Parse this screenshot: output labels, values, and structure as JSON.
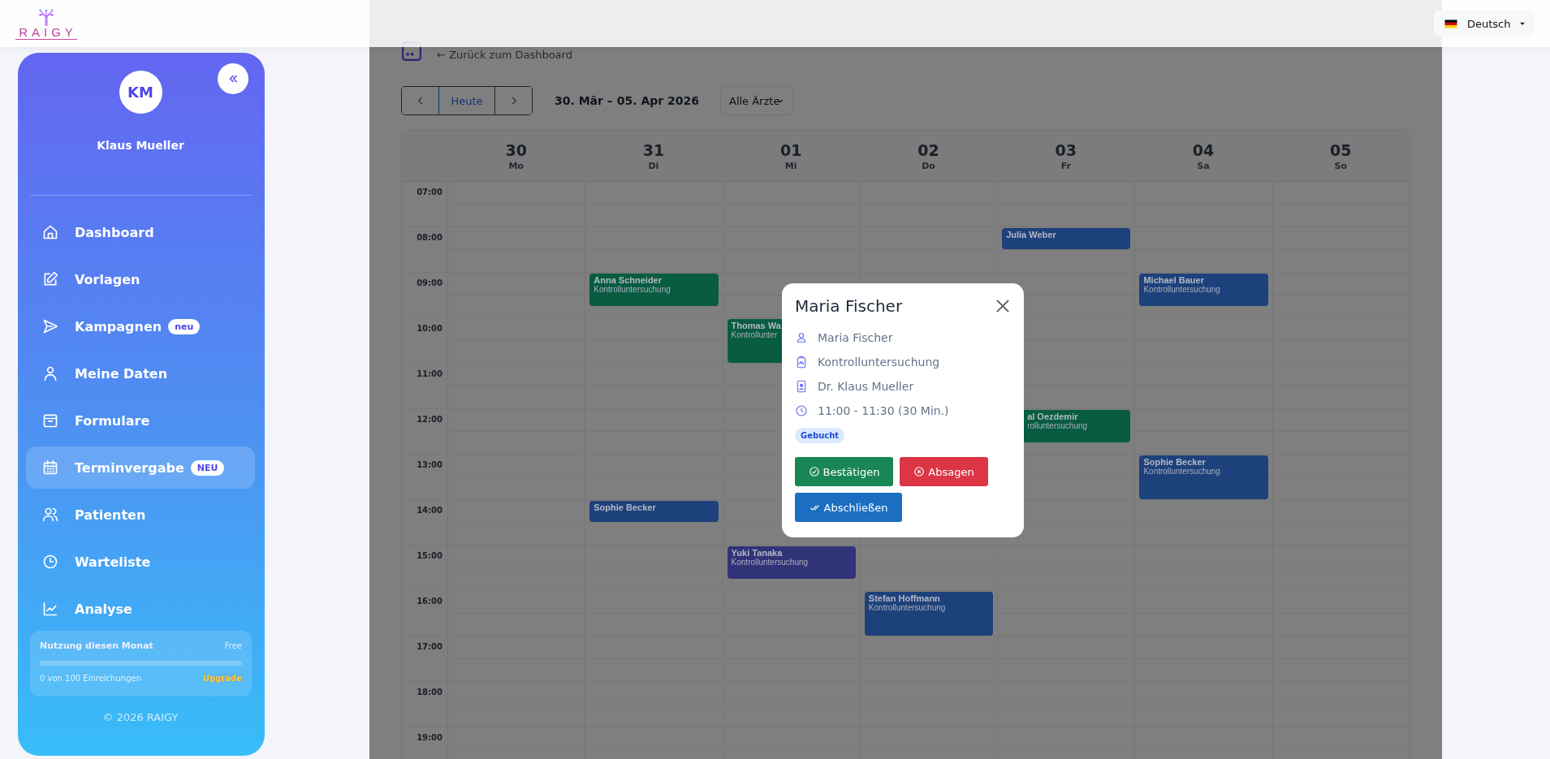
{
  "header": {
    "logo_text": "RAIGY",
    "language": "Deutsch"
  },
  "sidebar": {
    "avatar_initials": "KM",
    "user_name": "Klaus Mueller",
    "items": [
      {
        "label": "Dashboard",
        "selected": false
      },
      {
        "label": "Vorlagen",
        "selected": false
      },
      {
        "label": "Kampagnen",
        "badge": "neu",
        "selected": false
      },
      {
        "label": "Meine Daten",
        "selected": false
      },
      {
        "label": "Formulare",
        "selected": false
      },
      {
        "label": "Terminvergabe",
        "badge": "NEU",
        "selected": true
      },
      {
        "label": "Patienten",
        "selected": false
      },
      {
        "label": "Warteliste",
        "selected": false
      },
      {
        "label": "Analyse",
        "selected": false
      }
    ],
    "usage": {
      "title": "Nutzung diesen Monat",
      "plan": "Free",
      "level": 0,
      "count": "0 von 100 Einreichungen",
      "upgrade": "Upgrade"
    },
    "footer": "© 2026 RAIGY"
  },
  "calendar": {
    "back_link": "← Zurück zum Dashboard",
    "today": "Heute",
    "range": "30. Mär – 05. Apr 2026",
    "doctor_filter": "Alle Ärzte",
    "hours": [
      "07:00",
      "08:00",
      "09:00",
      "10:00",
      "11:00",
      "12:00",
      "13:00",
      "14:00",
      "15:00",
      "16:00",
      "17:00",
      "18:00",
      "19:00"
    ],
    "days": [
      {
        "date": "30",
        "weekday": "Mo",
        "slots": [
          {
            "kind": "free"
          },
          {
            "kind": "free"
          },
          {
            "kind": "free"
          },
          {
            "kind": "free"
          },
          {
            "kind": "free"
          },
          {
            "kind": "free"
          },
          {
            "kind": "free"
          },
          {
            "kind": "free"
          },
          {
            "kind": "free"
          },
          {
            "kind": "free"
          },
          {
            "kind": "free"
          },
          {
            "kind": "free"
          },
          {
            "kind": "free"
          }
        ]
      },
      {
        "date": "31",
        "weekday": "Di",
        "slots": [
          {
            "kind": "free"
          },
          {
            "kind": "free"
          },
          {
            "kind": "medium",
            "title": "Anna Schneider",
            "subtitle": "Kontrolluntersuchung",
            "color": "#085c40"
          },
          {
            "kind": "free"
          },
          {
            "kind": "free"
          },
          {
            "kind": "free"
          },
          {
            "kind": "free"
          },
          {
            "kind": "short",
            "title": "Sophie Becker",
            "color": "#1d417b"
          },
          {
            "kind": "free"
          },
          {
            "kind": "free"
          },
          {
            "kind": "free"
          },
          {
            "kind": "free"
          },
          {
            "kind": "free"
          }
        ]
      },
      {
        "date": "01",
        "weekday": "Mi",
        "slots": [
          {
            "kind": "free"
          },
          {
            "kind": "free"
          },
          {
            "kind": "free"
          },
          {
            "kind": "long",
            "title": "Thomas Wa",
            "subtitle": "Kontrollunter",
            "color": "#085c40"
          },
          {
            "kind": "free"
          },
          {
            "kind": "free"
          },
          {
            "kind": "free"
          },
          {
            "kind": "free"
          },
          {
            "kind": "medium",
            "title": "Yuki Tanaka",
            "subtitle": "Kontrolluntersuchung",
            "color": "#313378"
          },
          {
            "kind": "free"
          },
          {
            "kind": "free"
          },
          {
            "kind": "free"
          },
          {
            "kind": "free"
          }
        ]
      },
      {
        "date": "02",
        "weekday": "Do",
        "slots": [
          {
            "kind": "free"
          },
          {
            "kind": "free"
          },
          {
            "kind": "free"
          },
          {
            "kind": "free"
          },
          {
            "kind": "free"
          },
          {
            "kind": "free"
          },
          {
            "kind": "free"
          },
          {
            "kind": "free"
          },
          {
            "kind": "free"
          },
          {
            "kind": "long",
            "title": "Stefan Hoffmann",
            "subtitle": "Kontrolluntersuchung",
            "color": "#1d417b"
          },
          {
            "kind": "free"
          },
          {
            "kind": "free"
          },
          {
            "kind": "free"
          }
        ]
      },
      {
        "date": "03",
        "weekday": "Fr",
        "slots": [
          {
            "kind": "free"
          },
          {
            "kind": "short",
            "title": "Julia Weber",
            "color": "#1d417b"
          },
          {
            "kind": "free"
          },
          {
            "kind": "free"
          },
          {
            "kind": "free"
          },
          {
            "kind": "medium_covered",
            "title": "al Oezdemir",
            "subtitle": "rolluntersuchung",
            "color": "#085c40"
          },
          {
            "kind": "free"
          },
          {
            "kind": "free"
          },
          {
            "kind": "free"
          },
          {
            "kind": "free"
          },
          {
            "kind": "free"
          },
          {
            "kind": "free"
          },
          {
            "kind": "free"
          }
        ]
      },
      {
        "date": "04",
        "weekday": "Sa",
        "slots": [
          {
            "kind": "free"
          },
          {
            "kind": "free"
          },
          {
            "kind": "medium",
            "title": "Michael Bauer",
            "subtitle": "Kontrolluntersuchung",
            "color": "#1d417b"
          },
          {
            "kind": "free"
          },
          {
            "kind": "free"
          },
          {
            "kind": "free"
          },
          {
            "kind": "long",
            "title": "Sophie Becker",
            "subtitle": "Kontrolluntersuchung",
            "color": "#1d417b"
          },
          {
            "kind": "free"
          },
          {
            "kind": "free"
          },
          {
            "kind": "free"
          },
          {
            "kind": "free"
          },
          {
            "kind": "free"
          },
          {
            "kind": "free"
          }
        ]
      },
      {
        "date": "05",
        "weekday": "So",
        "slots": [
          {
            "kind": "free"
          },
          {
            "kind": "free"
          },
          {
            "kind": "free"
          },
          {
            "kind": "free"
          },
          {
            "kind": "free"
          },
          {
            "kind": "free"
          },
          {
            "kind": "free"
          },
          {
            "kind": "free"
          },
          {
            "kind": "free"
          },
          {
            "kind": "free"
          },
          {
            "kind": "free"
          },
          {
            "kind": "free"
          },
          {
            "kind": "free"
          }
        ]
      }
    ]
  },
  "modal": {
    "title": "Maria Fischer",
    "patient": "Maria Fischer",
    "service": "Kontrolluntersuchung",
    "doctor": "Dr. Klaus Mueller",
    "time": "11:00 - 11:30 (30 Min.)",
    "status": "Gebucht",
    "buttons": [
      {
        "label": "Bestätigen",
        "kind": "confirm"
      },
      {
        "label": "Absagen",
        "kind": "cancel"
      },
      {
        "label": "Abschließen",
        "kind": "complete"
      }
    ]
  }
}
